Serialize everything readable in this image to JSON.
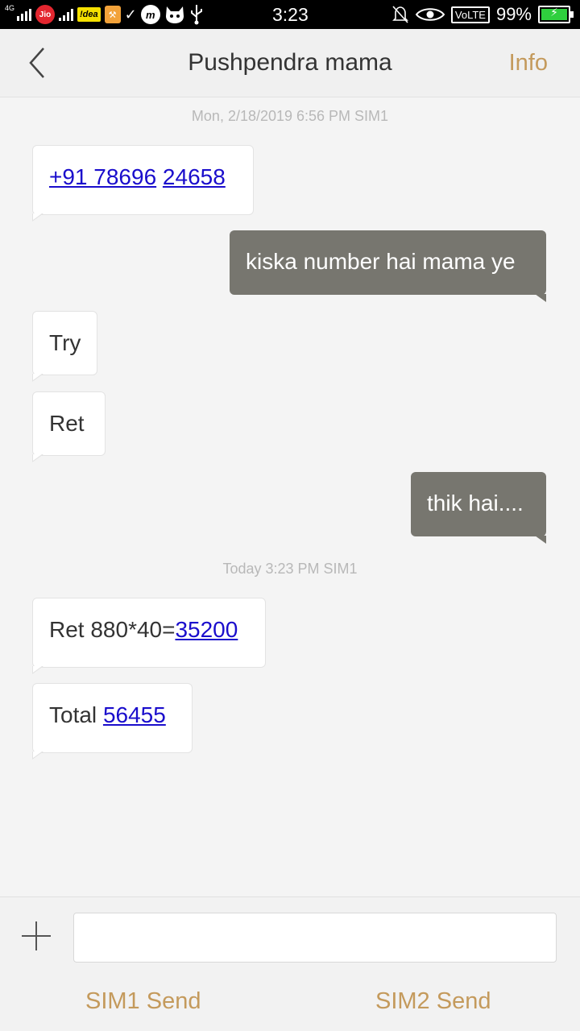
{
  "status_bar": {
    "network_label": "4G",
    "jio_label": "Jio",
    "idea_label": "!dea",
    "time": "3:23",
    "volte_label": "VoLTE",
    "battery_percent": "99%",
    "battery_level": 0.99,
    "battery_color": "#2fcf3e"
  },
  "header": {
    "title": "Pushpendra mama",
    "info_label": "Info",
    "accent_color": "#c49a5c"
  },
  "conversation": {
    "timestamp_1": "Mon, 2/18/2019  6:56 PM  SIM1",
    "msg1": {
      "direction": "incoming",
      "link_a": "+91 78696",
      "link_b": "24658"
    },
    "msg2": {
      "direction": "outgoing",
      "text": "kiska number hai mama ye"
    },
    "msg3": {
      "direction": "incoming",
      "text": "Try"
    },
    "msg4": {
      "direction": "incoming",
      "text": "Ret"
    },
    "msg5": {
      "direction": "outgoing",
      "text": "thik hai...."
    },
    "timestamp_2": "Today  3:23 PM  SIM1",
    "msg6": {
      "direction": "incoming",
      "prefix": "Ret 880*40=",
      "link": "35200"
    },
    "msg7": {
      "direction": "incoming",
      "prefix": "Total ",
      "link": "56455"
    }
  },
  "composer": {
    "input_value": "",
    "input_placeholder": "",
    "sim1_send_label": "SIM1 Send",
    "sim2_send_label": "SIM2 Send"
  }
}
